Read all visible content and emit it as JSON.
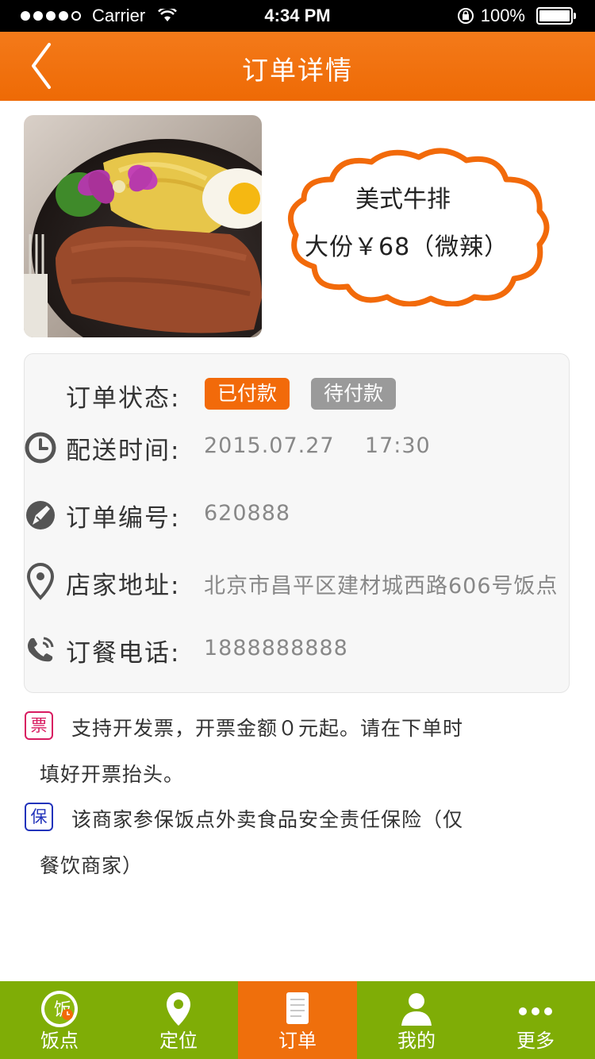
{
  "status_bar": {
    "carrier": "Carrier",
    "time": "4:34 PM",
    "battery": "100%"
  },
  "header": {
    "title": "订单详情",
    "back_icon": "chevron-left-icon"
  },
  "product": {
    "name": "美式牛排",
    "spec": "大份￥68（微辣）",
    "image": "steak-dish-photo"
  },
  "order_info": {
    "status_label": "订单状态:",
    "status_paid": "已付款",
    "status_unpaid": "待付款",
    "delivery_label": "配送时间:",
    "delivery_value": "2015.07.27    17:30",
    "number_label": "订单编号:",
    "number_value": "620888",
    "address_label": "店家地址:",
    "address_value": "北京市昌平区建材城西路606号饭点",
    "phone_label": "订餐电话:",
    "phone_value": "1888888888"
  },
  "notes": {
    "invoice_tag": "票",
    "invoice_line1": "支持开发票，开票金额０元起。请在下单时",
    "invoice_line2": "填好开票抬头。",
    "insure_tag": "保",
    "insure_line1": "该商家参保饭点外卖食品安全责任保险（仅",
    "insure_line2": "餐饮商家）"
  },
  "tabs": [
    {
      "label": "饭点",
      "icon": "restaurant-logo-icon",
      "active": false
    },
    {
      "label": "定位",
      "icon": "location-pin-icon",
      "active": false
    },
    {
      "label": "订单",
      "icon": "order-document-icon",
      "active": true
    },
    {
      "label": "我的",
      "icon": "user-icon",
      "active": false
    },
    {
      "label": "更多",
      "icon": "more-dots-icon",
      "active": false
    }
  ],
  "colors": {
    "accent": "#ef6f0c",
    "tabbar": "#7fad06",
    "paid": "#f26a0a",
    "unpaid": "#9a9a9a"
  }
}
